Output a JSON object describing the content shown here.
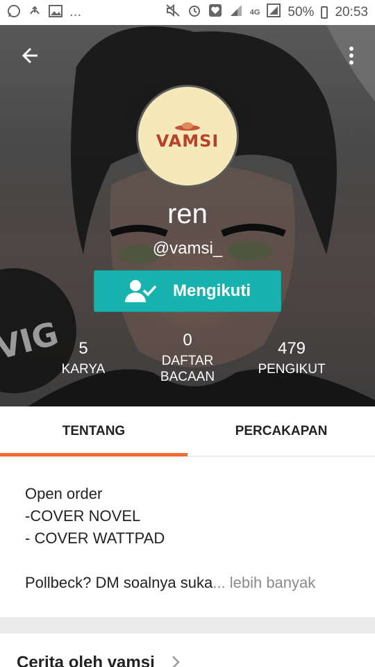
{
  "status_bar": {
    "left_icons": [
      "whatsapp-icon",
      "upload-icon",
      "image-icon",
      "more-icon"
    ],
    "more_text": "...",
    "network": "4G",
    "battery": "50%",
    "time": "20:53"
  },
  "header": {
    "avatar_text": "VAMSI",
    "display_name": "ren",
    "username": "@vamsi_",
    "follow_label": "Mengikuti"
  },
  "stats": [
    {
      "value": "5",
      "label_line1": "KARYA",
      "label_line2": ""
    },
    {
      "value": "0",
      "label_line1": "DAFTAR",
      "label_line2": "BACAAN"
    },
    {
      "value": "479",
      "label_line1": "PENGIKUT",
      "label_line2": ""
    }
  ],
  "tabs": [
    {
      "label": "TENTANG",
      "active": true
    },
    {
      "label": "PERCAKAPAN",
      "active": false
    }
  ],
  "about": {
    "line1": "Open order",
    "line2": "-COVER NOVEL",
    "line3": "- COVER WATTPAD",
    "line4": "Pollbeck? DM soalnya suka",
    "ellipsis": "...",
    "more_link": "lebih banyak"
  },
  "works": {
    "title": "Cerita oleh vamsi_"
  },
  "colors": {
    "accent_teal": "#18b3ae",
    "tab_indicator": "#f06a32"
  }
}
